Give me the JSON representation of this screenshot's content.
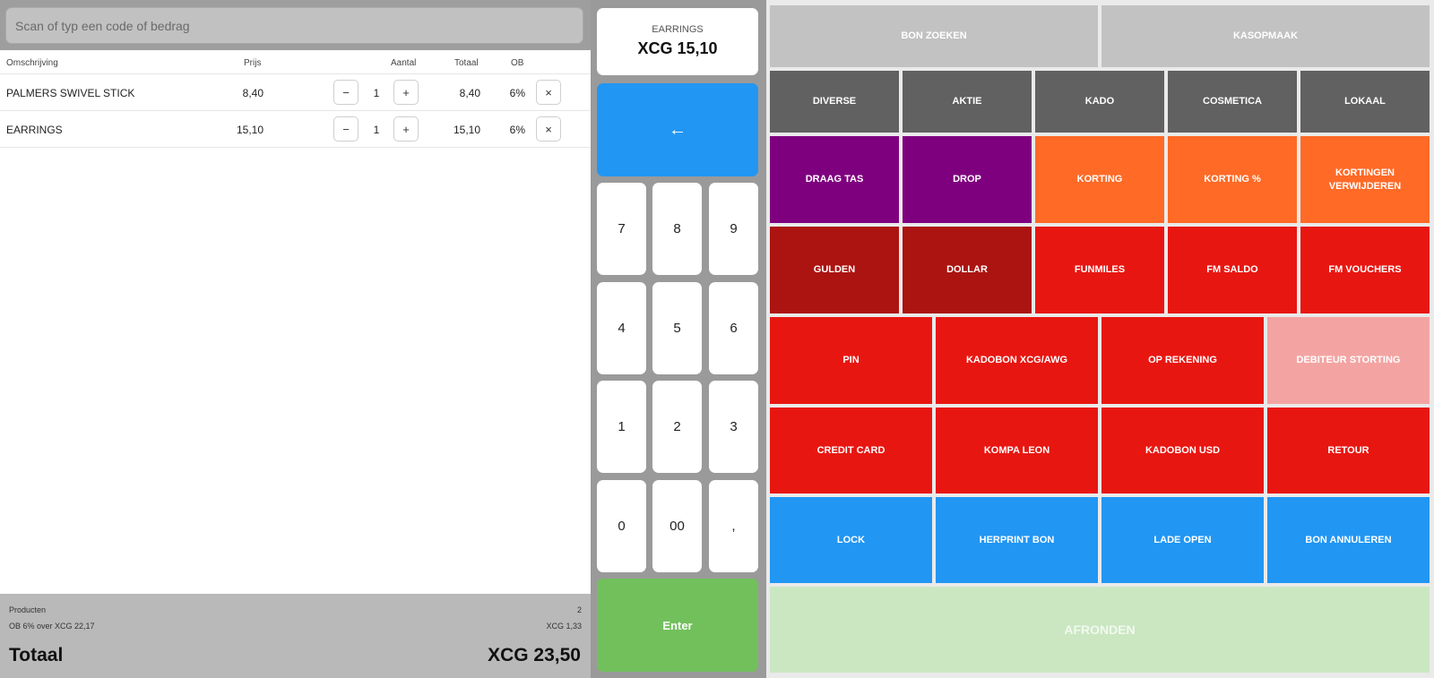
{
  "search": {
    "placeholder": "Scan of typ een code of bedrag"
  },
  "columns": {
    "description": "Omschrijving",
    "price": "Prijs",
    "qty": "Aantal",
    "total": "Totaal",
    "vat": "OB"
  },
  "items": [
    {
      "description": "PALMERS SWIVEL STICK",
      "price": "8,40",
      "qty": "1",
      "total": "8,40",
      "vat": "6%"
    },
    {
      "description": "EARRINGS",
      "price": "15,10",
      "qty": "1",
      "total": "15,10",
      "vat": "6%"
    }
  ],
  "row_buttons": {
    "minus": "−",
    "plus": "+",
    "delete": "×"
  },
  "footer": {
    "products_label": "Producten",
    "products_count": "2",
    "vat_label": "OB 6% over XCG 22,17",
    "vat_amount": "XCG 1,33",
    "total_label": "Totaal",
    "total_value": "XCG 23,50"
  },
  "display": {
    "label": "EARRINGS",
    "value": "XCG 15,10"
  },
  "keypad": {
    "backspace": "←",
    "keys": [
      "7",
      "8",
      "9",
      "4",
      "5",
      "6",
      "1",
      "2",
      "3",
      "0",
      "00",
      ","
    ],
    "enter": "Enter"
  },
  "functions": {
    "row1": [
      "BON ZOEKEN",
      "KASOPMAAK"
    ],
    "row2": [
      "DIVERSE",
      "AKTIE",
      "KADO",
      "COSMETICA",
      "LOKAAL"
    ],
    "row3": [
      "DRAAG TAS",
      "DROP",
      "KORTING",
      "KORTING %",
      "KORTINGEN VERWIJDEREN"
    ],
    "row4": [
      "GULDEN",
      "DOLLAR",
      "FUNMILES",
      "FM SALDO",
      "FM VOUCHERS"
    ],
    "row5": [
      "PIN",
      "KADOBON XCG/AWG",
      "OP REKENING",
      "DEBITEUR STORTING"
    ],
    "row6": [
      "CREDIT CARD",
      "KOMPA LEON",
      "KADOBON USD",
      "RETOUR"
    ],
    "row7": [
      "LOCK",
      "HERPRINT BON",
      "LADE OPEN",
      "BON ANNULEREN"
    ],
    "finish": "AFRONDEN"
  },
  "colors": {
    "blue": "#2196f3",
    "green": "#72c05c",
    "purple": "#7f007f",
    "orange": "#ff6a26",
    "dark_red": "#ab1411",
    "red": "#e81611",
    "pink": "#f3a4a2",
    "dark_grey": "#616161",
    "light_grey": "#c2c2c2",
    "light_green": "#cae7c2"
  }
}
